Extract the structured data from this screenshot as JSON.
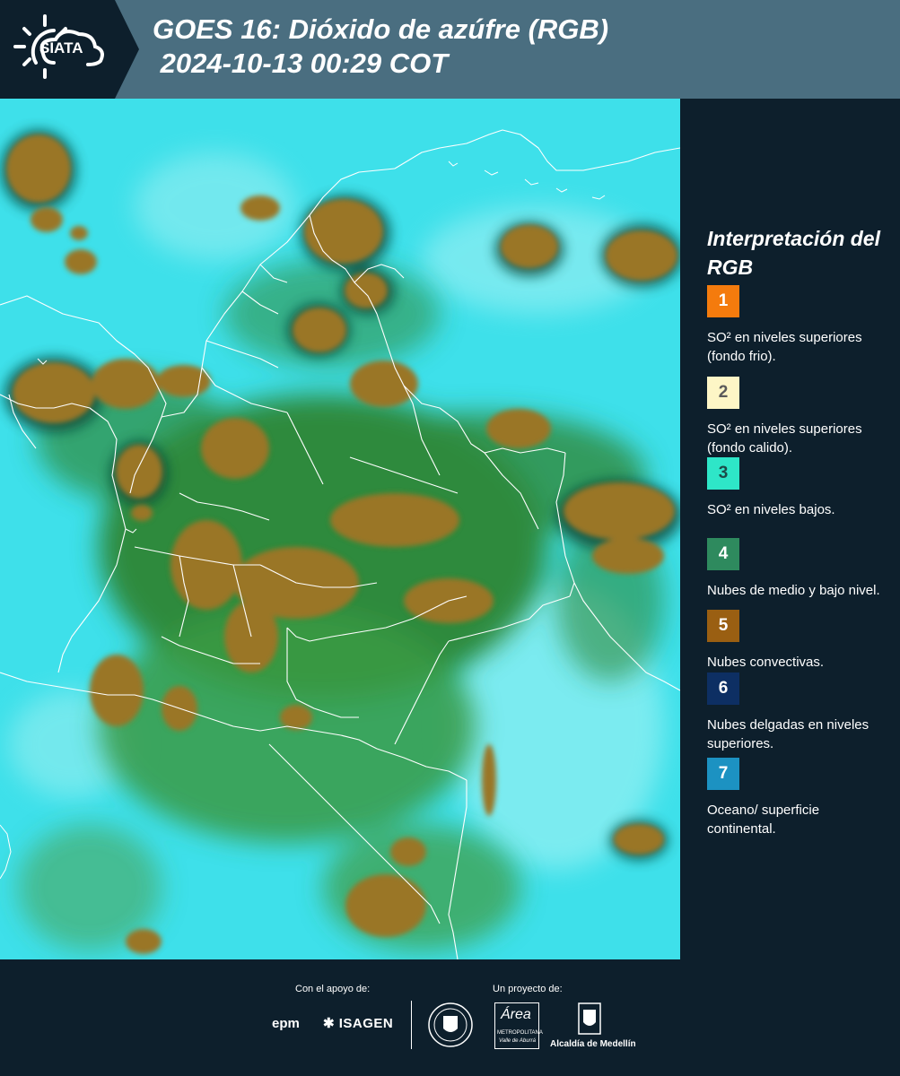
{
  "header": {
    "logo_text": "SIATA",
    "title": "GOES 16: Dióxido de azúfre (RGB)\n 2024-10-13 00:29 COT"
  },
  "legend": {
    "title": "Interpretación del RGB",
    "items": [
      {
        "number": "1",
        "label": "SO² en niveles superiores (fondo frio).",
        "color": "#f47b0d",
        "text_color": "#ffffff"
      },
      {
        "number": "2",
        "label": "SO² en niveles superiores (fondo calido).",
        "color": "#fdf6c6",
        "text_color": "#5a5a5a"
      },
      {
        "number": "3",
        "label": "SO² en niveles bajos.",
        "color": "#2ee6c8",
        "text_color": "#1d4a48"
      },
      {
        "number": "4",
        "label": "Nubes de medio y bajo nivel.",
        "color": "#2e8a5e",
        "text_color": "#ffffff"
      },
      {
        "number": "5",
        "label": "Nubes convectivas.",
        "color": "#9a5f12",
        "text_color": "#ffffff"
      },
      {
        "number": "6",
        "label": "Nubes delgadas en niveles superiores.",
        "color": "#0d2f63",
        "text_color": "#ffffff"
      },
      {
        "number": "7",
        "label": "Oceano/ superficie continental.",
        "color": "#1c92c2",
        "text_color": "#ffffff"
      }
    ]
  },
  "footer": {
    "support_label": "Con el apoyo de:",
    "project_label": "Un proyecto de:",
    "epm_logo": "epm",
    "isagen_logo": "ISAGEN",
    "area_logo": "Área",
    "area_sub": "METROPOLITANA",
    "area_sub2": "Valle de Aburrá",
    "alcaldia_logo": "Alcaldía de Medellín"
  },
  "colors": {
    "background": "#0d1f2c",
    "header_band": "#4a6e80",
    "ocean": "#3ee0ea",
    "convective": "#9a7628",
    "low_clouds": "#2f8a3c"
  }
}
